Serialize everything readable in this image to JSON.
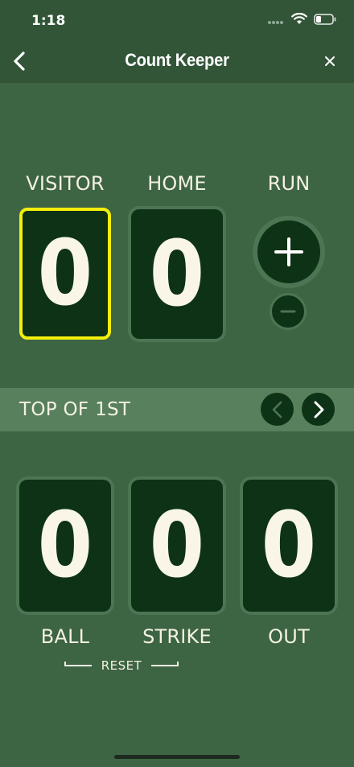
{
  "status": {
    "time": "1:18",
    "icons": [
      "signal-dots-icon",
      "wifi-icon",
      "battery-icon"
    ]
  },
  "nav": {
    "title": "Count Keeper",
    "back_icon": "chevron-left-icon",
    "close_icon": "close-icon"
  },
  "score": {
    "visitor_label": "VISITOR",
    "home_label": "HOME",
    "run_label": "RUN",
    "visitor_value": "0",
    "home_value": "0",
    "selected": "visitor"
  },
  "inning": {
    "text": "TOP OF 1ST",
    "prev_icon": "chevron-left-icon",
    "next_icon": "chevron-right-icon"
  },
  "count": {
    "ball_label": "BALL",
    "strike_label": "STRIKE",
    "out_label": "OUT",
    "ball_value": "0",
    "strike_value": "0",
    "out_value": "0",
    "reset_label": "RESET"
  },
  "colors": {
    "background": "#3d6443",
    "header": "#325538",
    "digit_box": "#0e3215",
    "selected_border": "#f2ef0d",
    "inning_bar": "#58805d",
    "text": "#f4f1e3"
  }
}
